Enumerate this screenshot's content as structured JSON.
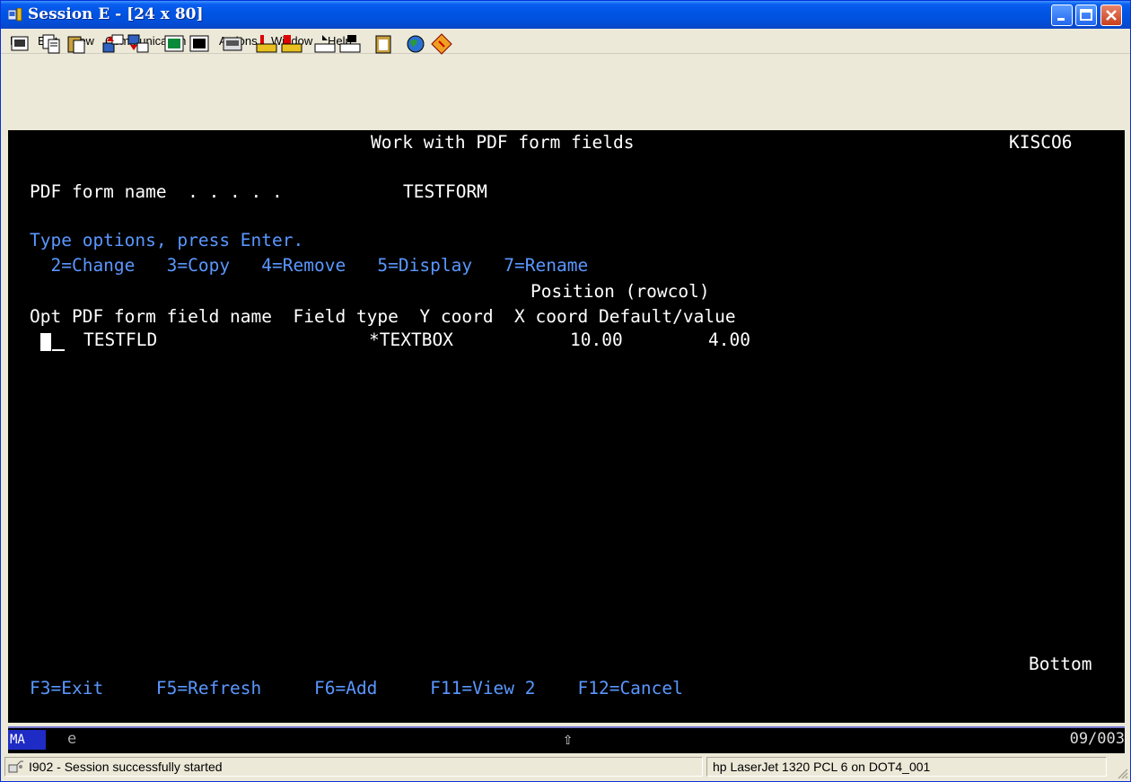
{
  "window": {
    "title": "Session E - [24 x 80]"
  },
  "menu": [
    "File",
    "Edit",
    "View",
    "Communication",
    "Actions",
    "Window",
    "Help"
  ],
  "toolbar": {
    "buttons": [
      "print-screen-icon",
      "copy-icon",
      "paste-icon",
      "send-file-icon",
      "receive-file-icon",
      "display-setup-icon",
      "keyboard-setup-icon",
      "macro-icon",
      "record-macro-icon",
      "play-macro-icon",
      "stop-macro-icon",
      "pause-macro-icon",
      "clipboard-icon",
      "web-globe-icon",
      "help-diamond-icon"
    ]
  },
  "terminal": {
    "title": "Work with PDF form fields",
    "system": "KISCO6",
    "form_name_label": "PDF form name  . . . . .",
    "form_name_value": "TESTFORM",
    "instructions": "Type options, press Enter.",
    "options": "  2=Change   3=Copy   4=Remove   5=Display   7=Rename",
    "position_header": "Position (rowcol)",
    "columns": "Opt PDF form field name  Field type  Y coord  X coord Default/value",
    "row": {
      "name": "TESTFLD",
      "type": "*TEXTBOX",
      "y": "10.00",
      "x": "4.00"
    },
    "bottom": "Bottom",
    "fkeys": "F3=Exit     F5=Refresh     F6=Add     F11=View 2    F12=Cancel"
  },
  "oia": {
    "mode": "MA",
    "indicator": "e",
    "shift": "⇧",
    "cursor_pos": "09/003"
  },
  "status": {
    "message": "I902 - Session successfully started",
    "printer": "hp LaserJet 1320 PCL 6 on DOT4_001"
  }
}
